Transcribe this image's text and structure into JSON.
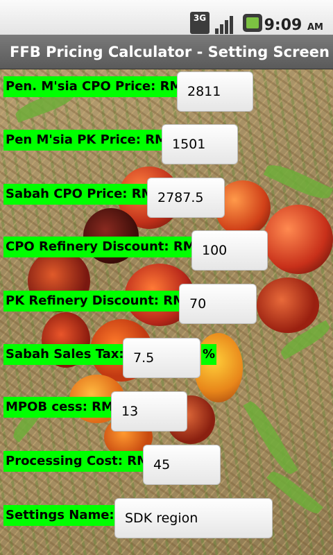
{
  "status_bar": {
    "network_label": "3G",
    "time": "9:09",
    "ampm": "AM",
    "icons": [
      "3g-icon",
      "signal-icon",
      "battery-icon"
    ]
  },
  "app": {
    "title": "FFB Pricing Calculator - Setting Screen"
  },
  "settings": [
    {
      "label": "Pen. M'sia CPO Price: RM",
      "value": "2811"
    },
    {
      "label": "Pen M'sia PK Price: RM",
      "value": "1501"
    },
    {
      "label": "Sabah CPO Price: RM",
      "value": "2787.5"
    },
    {
      "label": "CPO Refinery Discount: RM",
      "value": "100"
    },
    {
      "label": "PK Refinery Discount: RM",
      "value": "70"
    },
    {
      "label": "Sabah Sales Tax:",
      "value": "7.5",
      "unit": "%"
    },
    {
      "label": "MPOB cess: RM",
      "value": "13"
    },
    {
      "label": "Processing Cost: RM",
      "value": "45"
    },
    {
      "label": "Settings Name:",
      "value": "SDK region"
    }
  ],
  "colors": {
    "label_background": "#00ff00",
    "title_bar": "#6b6b6b"
  }
}
